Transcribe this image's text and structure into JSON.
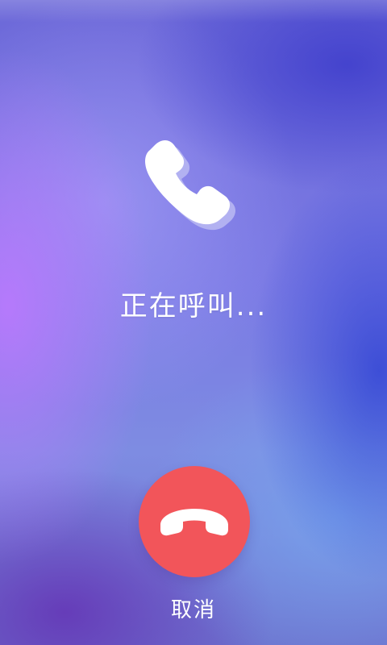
{
  "call": {
    "status_text": "正在呼叫...",
    "cancel_label": "取消"
  },
  "icons": {
    "call": "phone-icon",
    "hangup": "phone-hangup-icon"
  },
  "colors": {
    "hangup_button": "#f2555a",
    "text": "#ffffff",
    "phone_icon": "#ffffff",
    "phone_icon_shadow": "#b2b1f1"
  }
}
